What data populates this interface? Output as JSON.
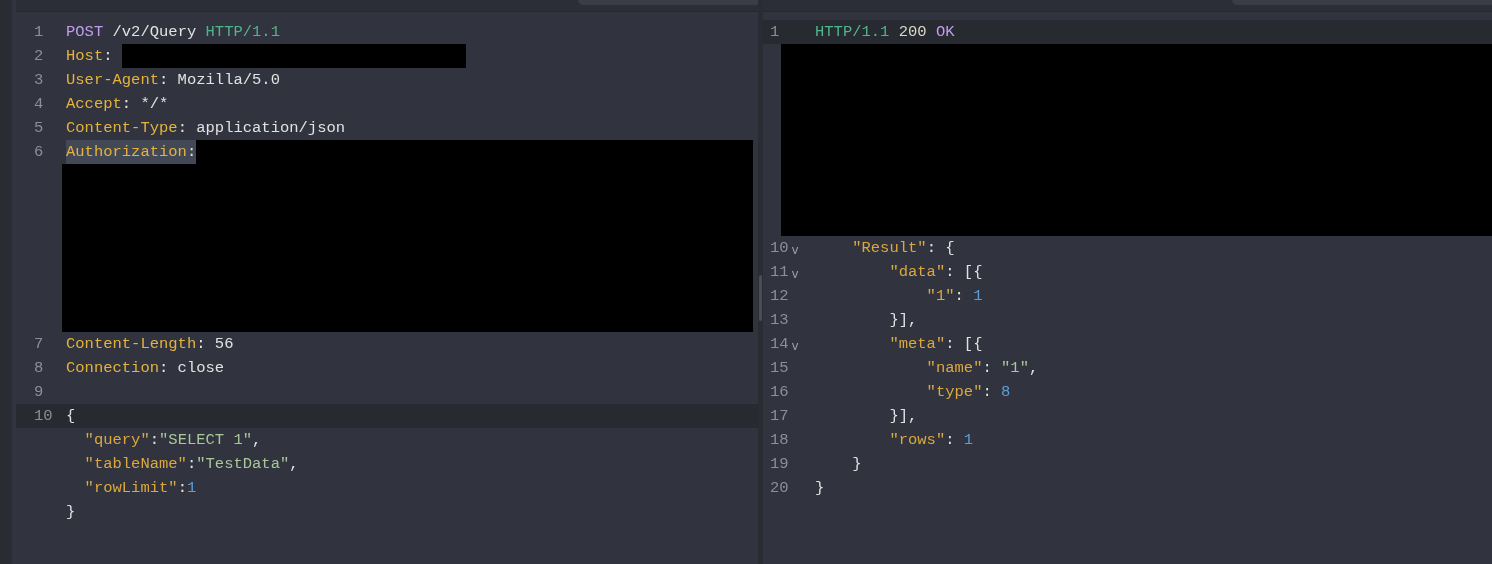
{
  "panes": [
    {
      "lines": [
        {
          "kind": "code",
          "number": "1",
          "current": false,
          "selected": false,
          "tokens": [
            {
              "kind": "method",
              "text": "POST"
            },
            {
              "kind": "plain",
              "text": " /v2/Query "
            },
            {
              "kind": "protocol",
              "text": "HTTP/1.1"
            }
          ]
        },
        {
          "kind": "code",
          "number": "2",
          "current": false,
          "selected": false,
          "tokens": [
            {
              "kind": "header",
              "text": "Host"
            },
            {
              "kind": "plain",
              "text": ": "
            },
            {
              "kind": "redacted"
            }
          ]
        },
        {
          "kind": "code",
          "number": "3",
          "current": false,
          "selected": false,
          "tokens": [
            {
              "kind": "header",
              "text": "User-Agent"
            },
            {
              "kind": "plain",
              "text": ": Mozilla/5.0"
            }
          ]
        },
        {
          "kind": "code",
          "number": "4",
          "current": false,
          "selected": false,
          "tokens": [
            {
              "kind": "header",
              "text": "Accept"
            },
            {
              "kind": "plain",
              "text": ": */*"
            }
          ]
        },
        {
          "kind": "code",
          "number": "5",
          "current": false,
          "selected": false,
          "tokens": [
            {
              "kind": "header",
              "text": "Content-Type"
            },
            {
              "kind": "plain",
              "text": ": application/json"
            }
          ]
        },
        {
          "kind": "code",
          "number": "6",
          "current": false,
          "selected": true,
          "tokens": [
            {
              "kind": "header",
              "text": "Authorization"
            },
            {
              "kind": "plain",
              "text": ":"
            },
            {
              "kind": "redacted_fill"
            }
          ]
        },
        {
          "kind": "redacted"
        },
        {
          "kind": "redacted"
        },
        {
          "kind": "redacted"
        },
        {
          "kind": "redacted"
        },
        {
          "kind": "redacted"
        },
        {
          "kind": "redacted"
        },
        {
          "kind": "redacted"
        },
        {
          "kind": "code",
          "number": "7",
          "current": false,
          "selected": false,
          "tokens": [
            {
              "kind": "header",
              "text": "Content-Length"
            },
            {
              "kind": "plain",
              "text": ": 56"
            }
          ]
        },
        {
          "kind": "code",
          "number": "8",
          "current": false,
          "selected": false,
          "tokens": [
            {
              "kind": "header",
              "text": "Connection"
            },
            {
              "kind": "plain",
              "text": ": close"
            }
          ]
        },
        {
          "kind": "code",
          "number": "9",
          "current": false,
          "selected": false
        },
        {
          "kind": "code",
          "number": "10",
          "current": true,
          "selected": false,
          "tokens": [
            {
              "kind": "plain",
              "text": "{"
            }
          ]
        },
        {
          "kind": "code",
          "current": false,
          "selected": false,
          "tokens": [
            {
              "kind": "key",
              "text": "  \"query\""
            },
            {
              "kind": "plain",
              "text": ":"
            },
            {
              "kind": "string",
              "text": "\"SELECT 1\""
            },
            {
              "kind": "plain",
              "text": ","
            }
          ]
        },
        {
          "kind": "code",
          "current": false,
          "selected": false,
          "tokens": [
            {
              "kind": "key",
              "text": "  \"tableName\""
            },
            {
              "kind": "plain",
              "text": ":"
            },
            {
              "kind": "string",
              "text": "\"TestData\""
            },
            {
              "kind": "plain",
              "text": ","
            }
          ]
        },
        {
          "kind": "code",
          "current": false,
          "selected": false,
          "tokens": [
            {
              "kind": "key",
              "text": "  \"rowLimit\""
            },
            {
              "kind": "plain",
              "text": ":"
            },
            {
              "kind": "number",
              "text": "1"
            }
          ]
        },
        {
          "kind": "code",
          "current": false,
          "selected": false,
          "tokens": [
            {
              "kind": "plain",
              "text": "}"
            }
          ]
        }
      ]
    },
    {
      "lines": [
        {
          "kind": "code",
          "number": "1",
          "current": true,
          "selected": false,
          "tokens": [
            {
              "kind": "protocol",
              "text": "HTTP/1.1"
            },
            {
              "kind": "status",
              "text": " 200"
            },
            {
              "kind": "method",
              "text": " OK"
            }
          ]
        },
        {
          "kind": "redacted"
        },
        {
          "kind": "redacted"
        },
        {
          "kind": "redacted"
        },
        {
          "kind": "redacted"
        },
        {
          "kind": "redacted"
        },
        {
          "kind": "redacted"
        },
        {
          "kind": "redacted"
        },
        {
          "kind": "redacted"
        },
        {
          "kind": "code",
          "number": "10",
          "fold_marker": "v",
          "current": false,
          "selected": false,
          "tokens": [
            {
              "kind": "key",
              "text": "    \"Result\""
            },
            {
              "kind": "plain",
              "text": ": {"
            }
          ]
        },
        {
          "kind": "code",
          "number": "11",
          "fold_marker": "v",
          "current": false,
          "selected": false,
          "tokens": [
            {
              "kind": "key",
              "text": "        \"data\""
            },
            {
              "kind": "plain",
              "text": ": [{"
            }
          ]
        },
        {
          "kind": "code",
          "number": "12",
          "current": false,
          "selected": false,
          "tokens": [
            {
              "kind": "key",
              "text": "            \"1\""
            },
            {
              "kind": "plain",
              "text": ": "
            },
            {
              "kind": "number",
              "text": "1"
            }
          ]
        },
        {
          "kind": "code",
          "number": "13",
          "current": false,
          "selected": false,
          "tokens": [
            {
              "kind": "plain",
              "text": "        }],"
            }
          ]
        },
        {
          "kind": "code",
          "number": "14",
          "fold_marker": "v",
          "current": false,
          "selected": false,
          "tokens": [
            {
              "kind": "key",
              "text": "        \"meta\""
            },
            {
              "kind": "plain",
              "text": ": [{"
            }
          ]
        },
        {
          "kind": "code",
          "number": "15",
          "current": false,
          "selected": false,
          "tokens": [
            {
              "kind": "key",
              "text": "            \"name\""
            },
            {
              "kind": "plain",
              "text": ": "
            },
            {
              "kind": "string",
              "text": "\"1\""
            },
            {
              "kind": "plain",
              "text": ","
            }
          ]
        },
        {
          "kind": "code",
          "number": "16",
          "current": false,
          "selected": false,
          "tokens": [
            {
              "kind": "key",
              "text": "            \"type\""
            },
            {
              "kind": "plain",
              "text": ": "
            },
            {
              "kind": "number",
              "text": "8"
            }
          ]
        },
        {
          "kind": "code",
          "number": "17",
          "current": false,
          "selected": false,
          "tokens": [
            {
              "kind": "plain",
              "text": "        }],"
            }
          ]
        },
        {
          "kind": "code",
          "number": "18",
          "current": false,
          "selected": false,
          "tokens": [
            {
              "kind": "key",
              "text": "        \"rows\""
            },
            {
              "kind": "plain",
              "text": ": "
            },
            {
              "kind": "number",
              "text": "1"
            }
          ]
        },
        {
          "kind": "code",
          "number": "19",
          "current": false,
          "selected": false,
          "tokens": [
            {
              "kind": "plain",
              "text": "    }"
            }
          ]
        },
        {
          "kind": "code",
          "number": "20",
          "current": false,
          "selected": false,
          "tokens": [
            {
              "kind": "plain",
              "text": "}"
            }
          ]
        }
      ]
    }
  ]
}
